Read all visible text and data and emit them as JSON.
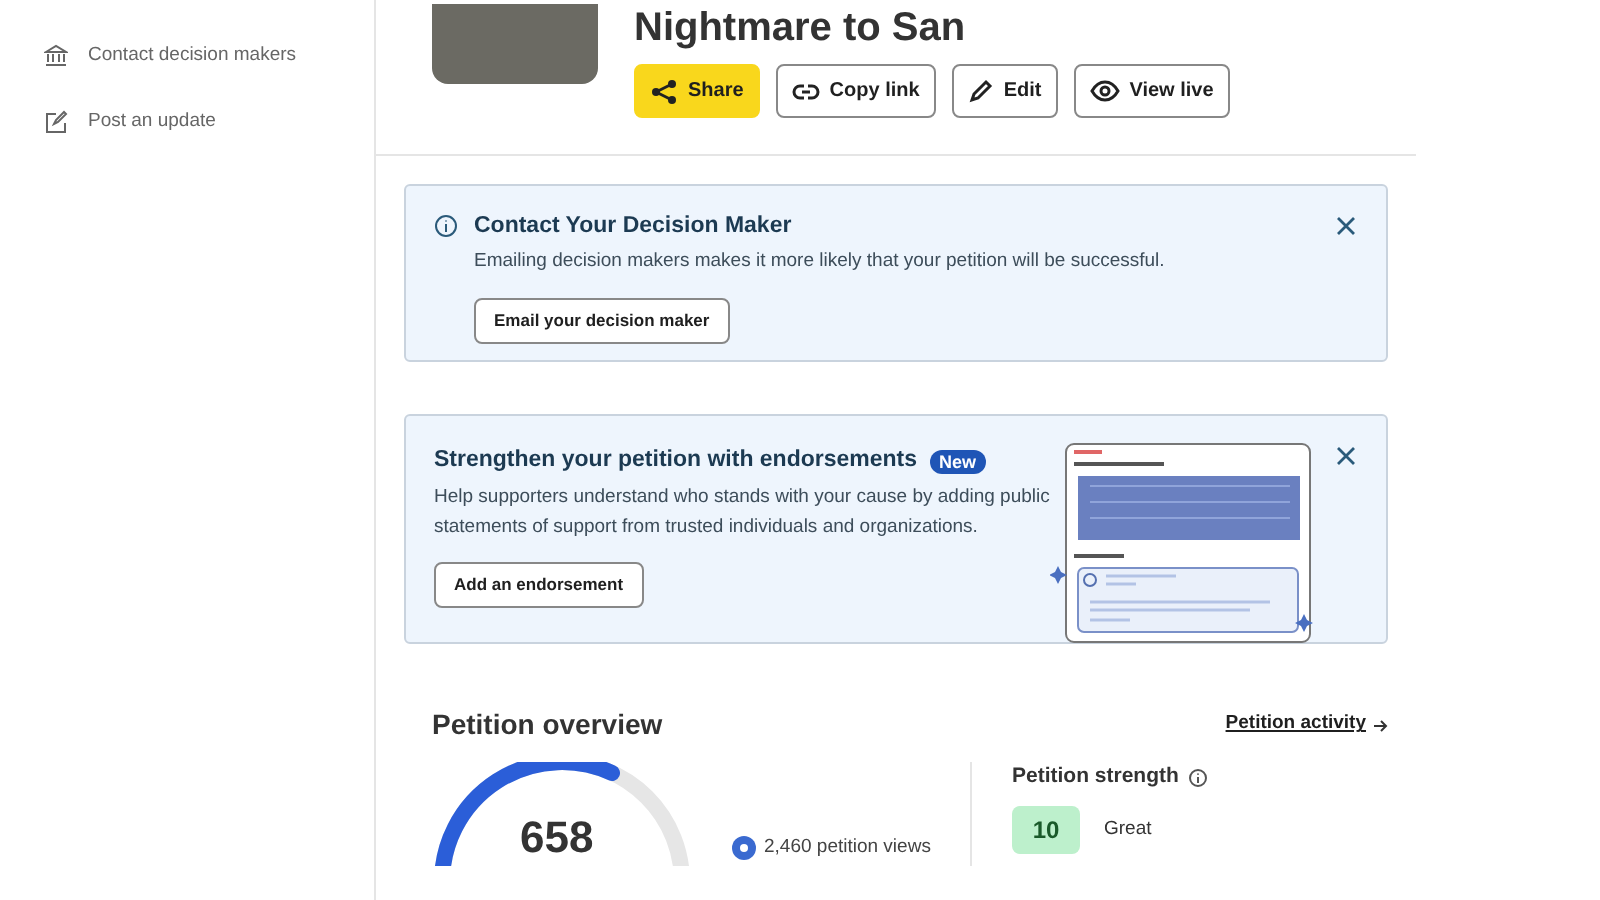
{
  "sidebar": {
    "items": [
      {
        "label": "Contact decision makers"
      },
      {
        "label": "Post an update"
      }
    ]
  },
  "petition": {
    "title": "Nightmare to San",
    "actions": [
      {
        "label": "Share",
        "kind": "primary"
      },
      {
        "label": "Copy link",
        "kind": "outline"
      },
      {
        "label": "Edit",
        "kind": "outline"
      },
      {
        "label": "View live",
        "kind": "outline"
      }
    ]
  },
  "cards": [
    {
      "kind": "info",
      "title": "Contact Your Decision Maker",
      "text": "Emailing decision makers makes it more likely that your petition will be successful.",
      "button": "Email your decision maker"
    },
    {
      "kind": "promo",
      "title": "Strengthen your petition with endorsements",
      "badge": "New",
      "text": "Help supporters understand who stands with your cause by adding public statements of support from trusted individuals and organizations.",
      "button": "Add an endorsement"
    }
  ],
  "overview": {
    "title": "Petition overview",
    "link": "Petition activity",
    "gauge": {
      "value": "658"
    },
    "views": "2,460 petition views",
    "strength": {
      "title": "Petition strength",
      "score": "10",
      "rating": "Great"
    }
  }
}
